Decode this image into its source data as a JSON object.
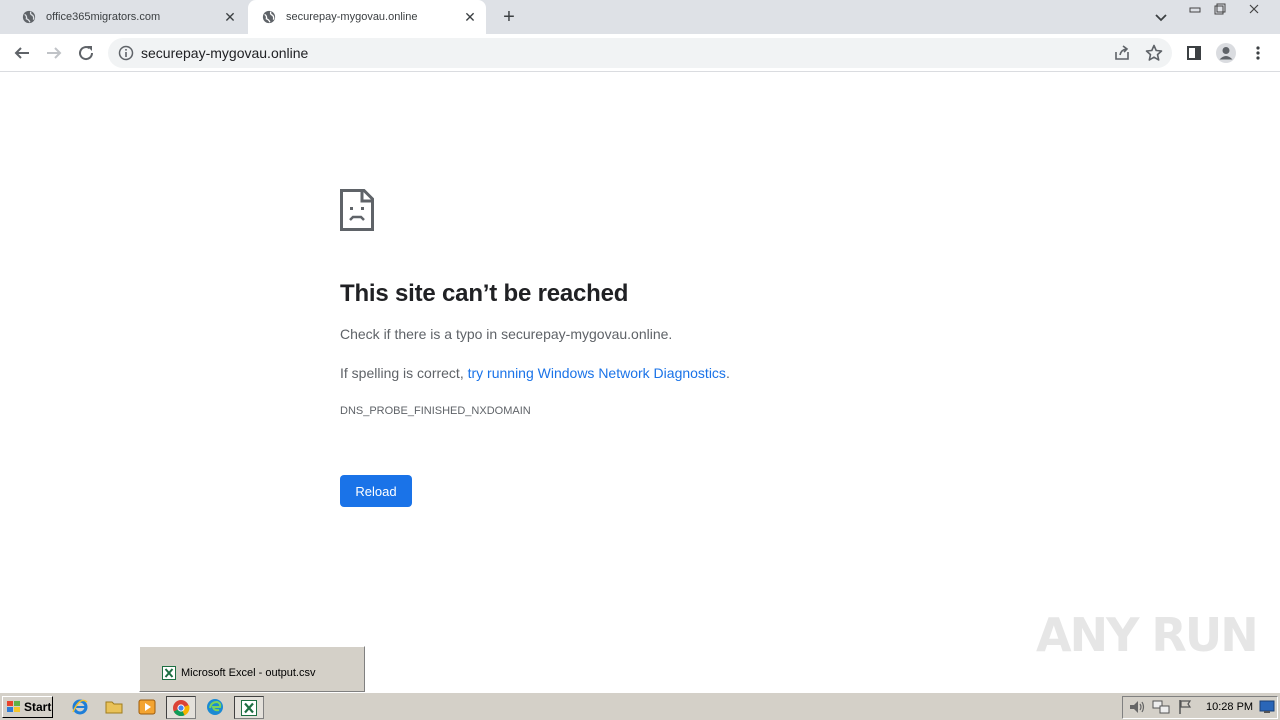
{
  "browser": {
    "tabs": [
      {
        "title": "office365migrators.com",
        "active": false
      },
      {
        "title": "securepay-mygovau.online",
        "active": true
      }
    ],
    "url": "securepay-mygovau.online"
  },
  "error_page": {
    "heading": "This site can’t be reached",
    "typo_text": "Check if there is a typo in securepay-mygovau.online.",
    "spelling_prefix": "If spelling is correct, ",
    "diagnostics_link": "try running Windows Network Diagnostics",
    "spelling_suffix": ".",
    "error_code": "DNS_PROBE_FINISHED_NXDOMAIN",
    "reload_label": "Reload"
  },
  "watermark": "ANY RUN",
  "taskbar": {
    "start_label": "Start",
    "excel_popup_label": "Microsoft Excel - output.csv",
    "clock": "10:28 PM"
  },
  "colors": {
    "accent": "#1a73e8",
    "tabstrip": "#dee1e6",
    "taskbar": "#d4d0c8"
  }
}
